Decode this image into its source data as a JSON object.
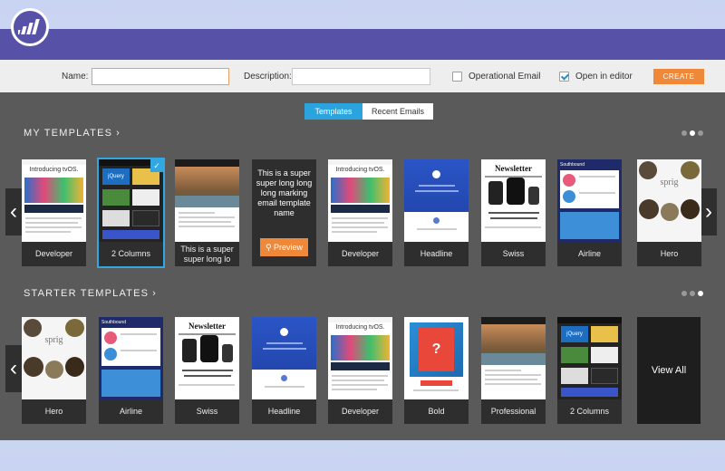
{
  "form": {
    "name_label": "Name:",
    "name_value": "",
    "description_label": "Description:",
    "description_value": "",
    "operational_label": "Operational Email",
    "operational_checked": false,
    "open_editor_label": "Open in editor",
    "open_editor_checked": true,
    "create_label": "CREATE"
  },
  "tabs": {
    "templates": "Templates",
    "recent": "Recent Emails"
  },
  "my_templates": {
    "title": "MY TEMPLATES",
    "cards": [
      {
        "label": "Developer",
        "thumb": "Introducing tvOS."
      },
      {
        "label": "2 Columns",
        "thumb": "jQuery",
        "selected": true
      },
      {
        "label": "This is a super super long lo",
        "thumb": "resort"
      },
      {
        "label": "This is a super super long long long marking email template name",
        "preview": "Preview"
      },
      {
        "label": "Developer",
        "thumb": "Introducing tvOS."
      },
      {
        "label": "Headline",
        "thumb": "blue"
      },
      {
        "label": "Swiss",
        "thumb": "Newsletter"
      },
      {
        "label": "Airline",
        "thumb": "Southbound"
      },
      {
        "label": "Hero",
        "thumb": "sprig"
      }
    ]
  },
  "starter_templates": {
    "title": "STARTER TEMPLATES",
    "cards": [
      {
        "label": "Hero",
        "thumb": "sprig"
      },
      {
        "label": "Airline",
        "thumb": "Southbound"
      },
      {
        "label": "Swiss",
        "thumb": "Newsletter"
      },
      {
        "label": "Headline",
        "thumb": "blue"
      },
      {
        "label": "Developer",
        "thumb": "Introducing tvOS."
      },
      {
        "label": "Bold",
        "thumb": "bold"
      },
      {
        "label": "Professional",
        "thumb": "resort"
      },
      {
        "label": "2 Columns",
        "thumb": "jQuery"
      }
    ],
    "view_all": "View All"
  },
  "thumb_text": {
    "tvos": "Introducing tvOS.",
    "newsletter": "Newsletter",
    "sprig": "sprig",
    "jquery": "jQuery",
    "southbound": "Southbound",
    "bold": "?"
  },
  "colors": {
    "header": "#5751a8",
    "accent": "#f0883a",
    "tab_active": "#2aa3df",
    "selected": "#31a8e3"
  }
}
